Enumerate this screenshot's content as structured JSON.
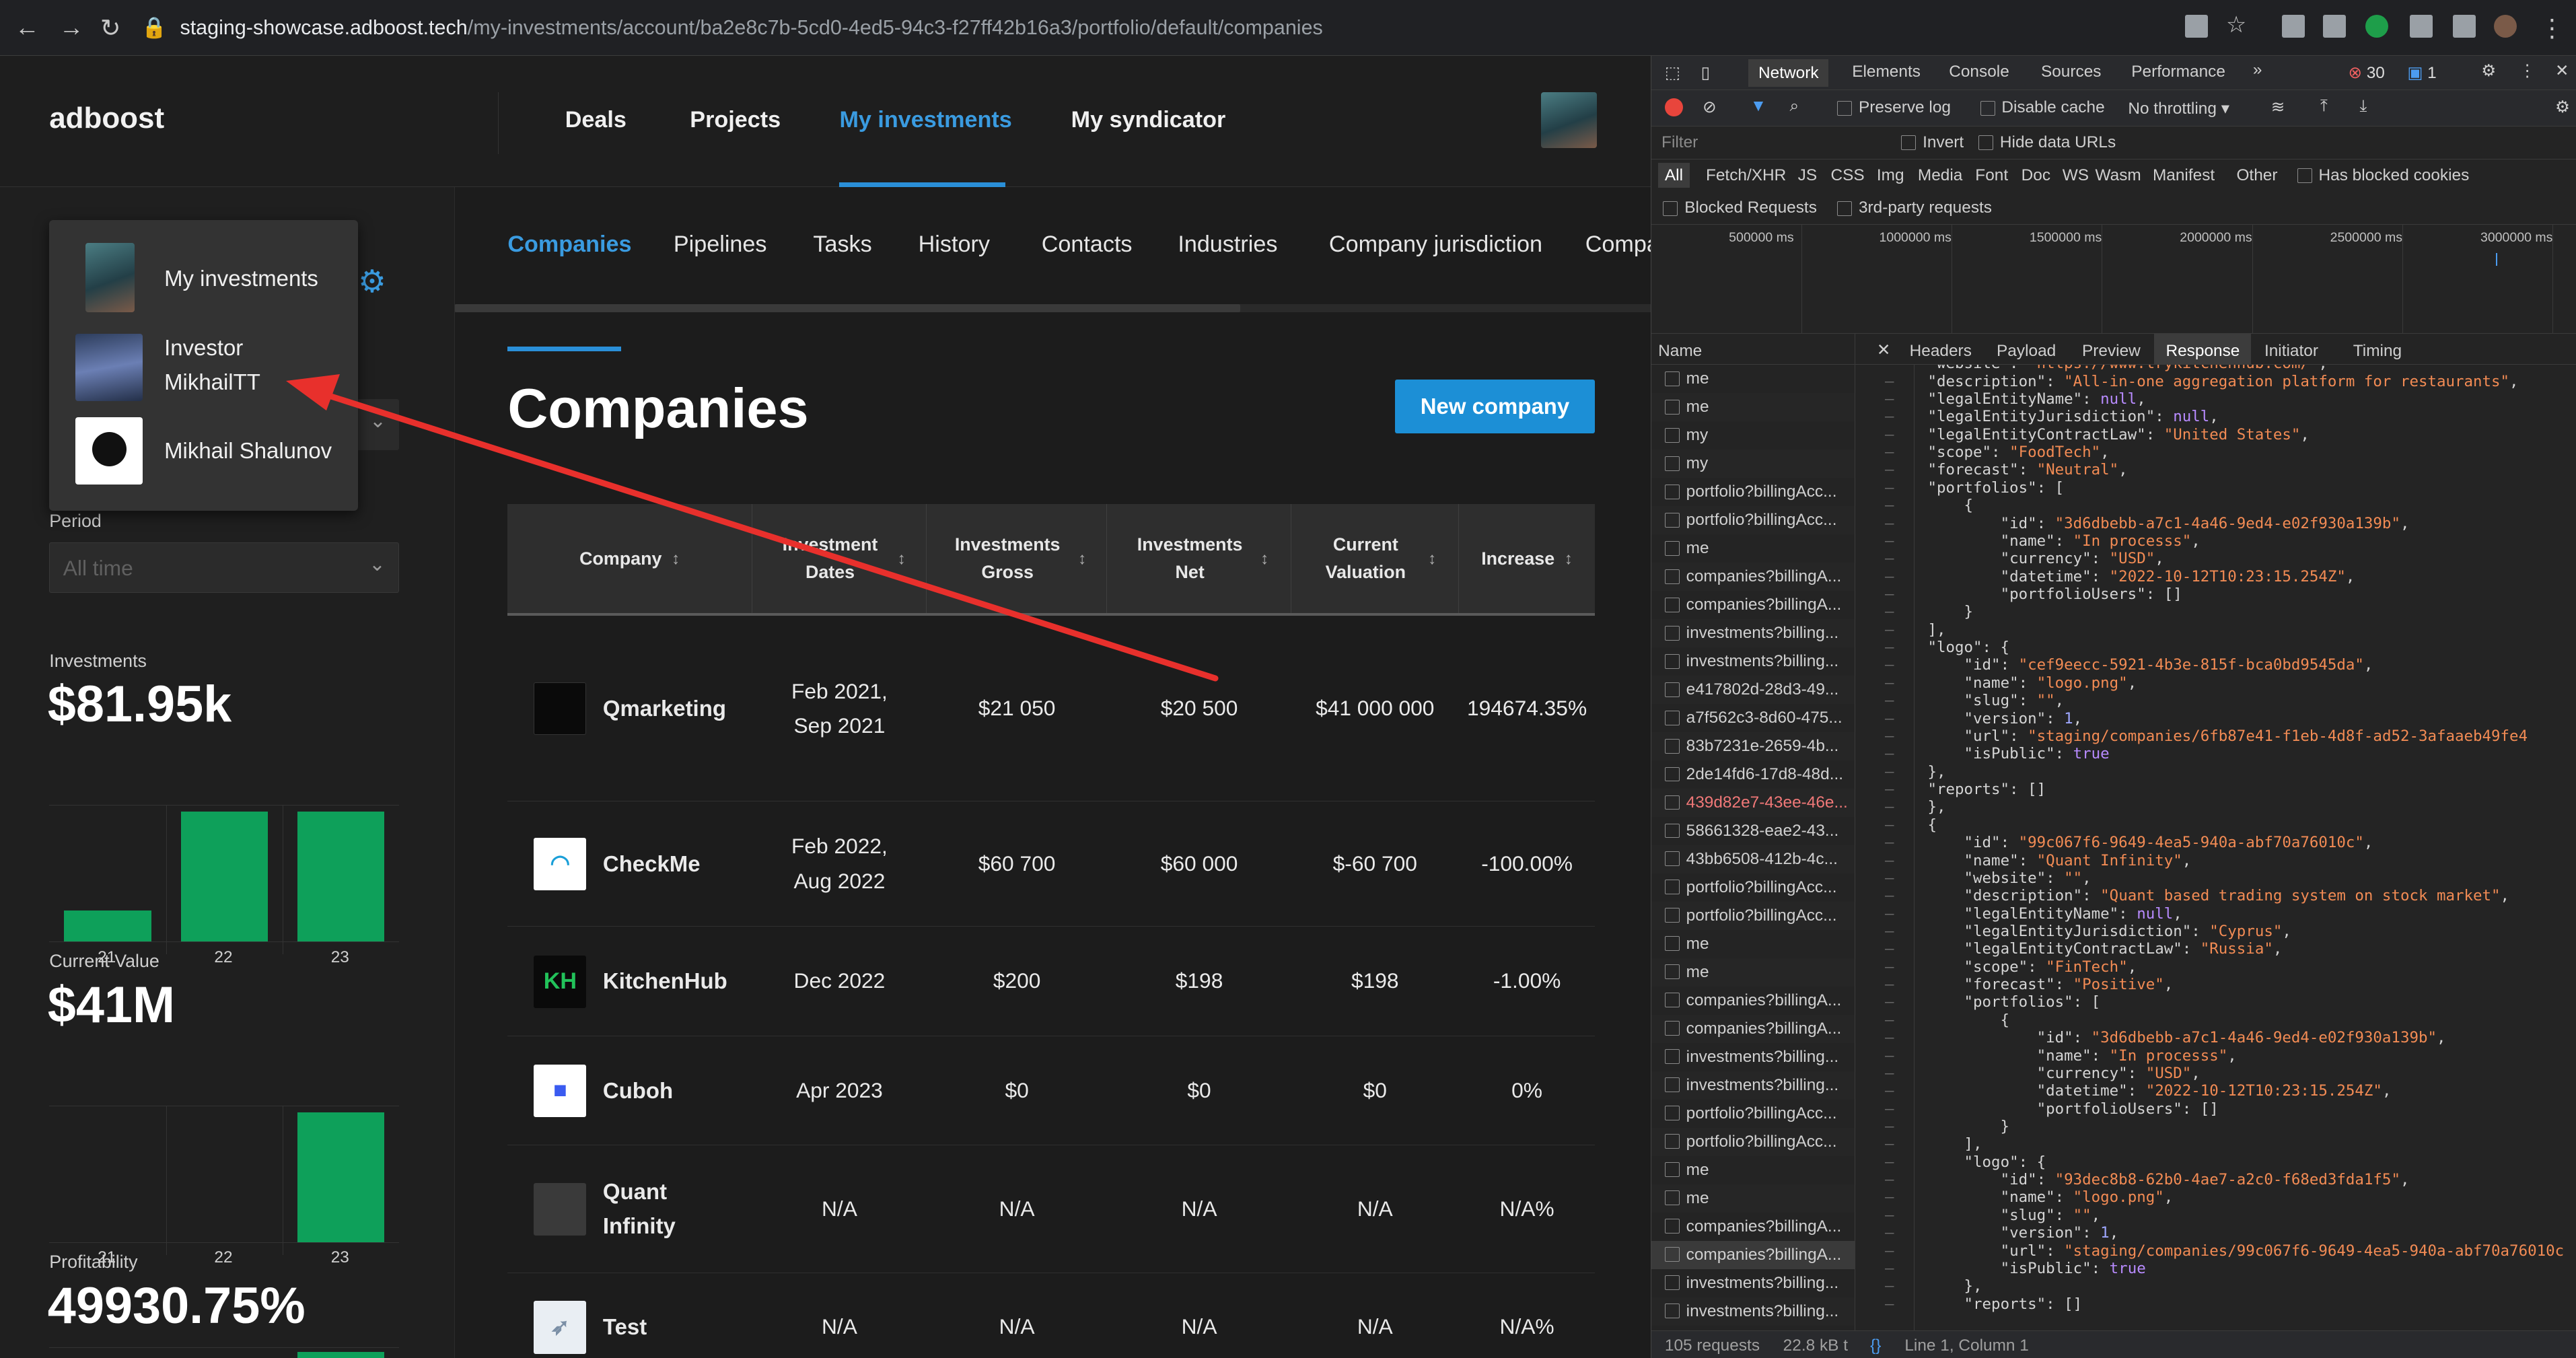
{
  "browser": {
    "url_host": "staging-showcase.adboost.tech",
    "url_path": "/my-investments/account/ba2e8c7b-5cd0-4ed5-94c3-f27ff42b16a3/portfolio/default/companies"
  },
  "app": {
    "logo": "adboost",
    "nav": [
      "Deals",
      "Projects",
      "My investments",
      "My syndicator"
    ],
    "active_nav": "My investments"
  },
  "dropdown": {
    "items": [
      {
        "label": "My investments"
      },
      {
        "line1": "Investor",
        "line2": "MikhailTT"
      },
      {
        "label": "Mikhail Shalunov"
      }
    ]
  },
  "sidebar": {
    "period_label": "Period",
    "period_value": "All time",
    "investments_label": "Investments",
    "investments_value": "$81.95k",
    "investments_chart": {
      "x": [
        "21",
        "22",
        "23"
      ],
      "y": [
        0.24,
        1.0,
        1.0
      ]
    },
    "current_value_label": "Current Value",
    "current_value_value": "$41M",
    "current_value_chart": {
      "x": [
        "21",
        "22",
        "23"
      ],
      "y": [
        0,
        0,
        1.0
      ]
    },
    "profitability_label": "Profitability",
    "profitability_value": "49930.75%"
  },
  "subnav": [
    "Companies",
    "Pipelines",
    "Tasks",
    "History",
    "Contacts",
    "Industries",
    "Company jurisdiction",
    "Compa"
  ],
  "main": {
    "title": "Companies",
    "new_button": "New company",
    "columns": [
      "Company",
      "Investment Dates",
      "Investments Gross",
      "Investments Net",
      "Current Valuation",
      "Increase"
    ],
    "rows": [
      {
        "name": "Qmarketing",
        "dates": "Feb 2021,\nSep 2021",
        "gross": "$21 050",
        "net": "$20 500",
        "valuation": "$41 000 000",
        "increase": "194674.35%"
      },
      {
        "name": "CheckMe",
        "dates": "Feb 2022,\nAug 2022",
        "gross": "$60 700",
        "net": "$60 000",
        "valuation": "$-60 700",
        "increase": "-100.00%"
      },
      {
        "name": "KitchenHub",
        "dates": "Dec 2022",
        "gross": "$200",
        "net": "$198",
        "valuation": "$198",
        "increase": "-1.00%"
      },
      {
        "name": "Cuboh",
        "dates": "Apr 2023",
        "gross": "$0",
        "net": "$0",
        "valuation": "$0",
        "increase": "0%"
      },
      {
        "name": "Quant\nInfinity",
        "dates": "N/A",
        "gross": "N/A",
        "net": "N/A",
        "valuation": "N/A",
        "increase": "N/A%"
      },
      {
        "name": "Test",
        "dates": "N/A",
        "gross": "N/A",
        "net": "N/A",
        "valuation": "N/A",
        "increase": "N/A%"
      }
    ]
  },
  "devtools": {
    "tabs": [
      "Network",
      "Elements",
      "Console",
      "Sources",
      "Performance"
    ],
    "errors": "30",
    "messages": "1",
    "preserve_log": "Preserve log",
    "disable_cache": "Disable cache",
    "throttling": "No throttling",
    "filter_placeholder": "Filter",
    "invert": "Invert",
    "hide_data_urls": "Hide data URLs",
    "type_filters": [
      "All",
      "Fetch/XHR",
      "JS",
      "CSS",
      "Img",
      "Media",
      "Font",
      "Doc",
      "WS",
      "Wasm",
      "Manifest",
      "Other"
    ],
    "has_blocked_cookies": "Has blocked cookies",
    "blocked_requests": "Blocked Requests",
    "third_party": "3rd-party requests",
    "timeline_ticks": [
      "500000 ms",
      "1000000 ms",
      "1500000 ms",
      "2000000 ms",
      "2500000 ms",
      "3000000 ms"
    ],
    "name_header": "Name",
    "detail_tabs": [
      "Headers",
      "Payload",
      "Preview",
      "Response",
      "Initiator",
      "Timing"
    ],
    "active_detail_tab": "Response",
    "requests": [
      "me",
      "me",
      "my",
      "my",
      "portfolio?billingAcc...",
      "portfolio?billingAcc...",
      "me",
      "companies?billingA...",
      "companies?billingA...",
      "investments?billing...",
      "investments?billing...",
      "e417802d-28d3-49...",
      "a7f562c3-8d60-475...",
      "83b7231e-2659-4b...",
      "2de14fd6-17d8-48d...",
      "439d82e7-43ee-46e...",
      "58661328-eae2-43...",
      "43bb6508-412b-4c...",
      "portfolio?billingAcc...",
      "portfolio?billingAcc...",
      "me",
      "me",
      "companies?billingA...",
      "companies?billingA...",
      "investments?billing...",
      "investments?billing...",
      "portfolio?billingAcc...",
      "portfolio?billingAcc...",
      "me",
      "me",
      "companies?billingA...",
      "companies?billingA...",
      "investments?billing...",
      "investments?billing..."
    ],
    "code_lines": [
      "\"website\": \"https://www.trykitchenhub.com/\",",
      "\"description\": \"All-in-one aggregation platform for restaurants\",",
      "\"legalEntityName\": null,",
      "\"legalEntityJurisdiction\": null,",
      "\"legalEntityContractLaw\": \"United States\",",
      "\"scope\": \"FoodTech\",",
      "\"forecast\": \"Neutral\",",
      "\"portfolios\": [",
      "    {",
      "        \"id\": \"3d6dbebb-a7c1-4a46-9ed4-e02f930a139b\",",
      "        \"name\": \"In processs\",",
      "        \"currency\": \"USD\",",
      "        \"datetime\": \"2022-10-12T10:23:15.254Z\",",
      "        \"portfolioUsers\": []",
      "    }",
      "],",
      "\"logo\": {",
      "    \"id\": \"cef9eecc-5921-4b3e-815f-bca0bd9545da\",",
      "    \"name\": \"logo.png\",",
      "    \"slug\": \"\",",
      "    \"version\": 1,",
      "    \"url\": \"staging/companies/6fb87e41-f1eb-4d8f-ad52-3afaaeb49fe4",
      "    \"isPublic\": true",
      "},",
      "\"reports\": []",
      "},",
      "{",
      "    \"id\": \"99c067f6-9649-4ea5-940a-abf70a76010c\",",
      "    \"name\": \"Quant Infinity\",",
      "    \"website\": \"\",",
      "    \"description\": \"Quant based trading system on stock market\",",
      "    \"legalEntityName\": null,",
      "    \"legalEntityJurisdiction\": \"Cyprus\",",
      "    \"legalEntityContractLaw\": \"Russia\",",
      "    \"scope\": \"FinTech\",",
      "    \"forecast\": \"Positive\",",
      "    \"portfolios\": [",
      "        {",
      "            \"id\": \"3d6dbebb-a7c1-4a46-9ed4-e02f930a139b\",",
      "            \"name\": \"In processs\",",
      "            \"currency\": \"USD\",",
      "            \"datetime\": \"2022-10-12T10:23:15.254Z\",",
      "            \"portfolioUsers\": []",
      "        }",
      "    ],",
      "    \"logo\": {",
      "        \"id\": \"93dec8b8-62b0-4ae7-a2c0-f68ed3fda1f5\",",
      "        \"name\": \"logo.png\",",
      "        \"slug\": \"\",",
      "        \"version\": 1,",
      "        \"url\": \"staging/companies/99c067f6-9649-4ea5-940a-abf70a76010c",
      "        \"isPublic\": true",
      "    },",
      "    \"reports\": []"
    ],
    "status_requests": "105 requests",
    "status_size": "22.8 kB t",
    "status_cursor": "Line 1, Column 1"
  },
  "colors": {
    "accent": "#2a8fd8",
    "bar": "#0ea05a",
    "arrow": "#e8302c"
  }
}
